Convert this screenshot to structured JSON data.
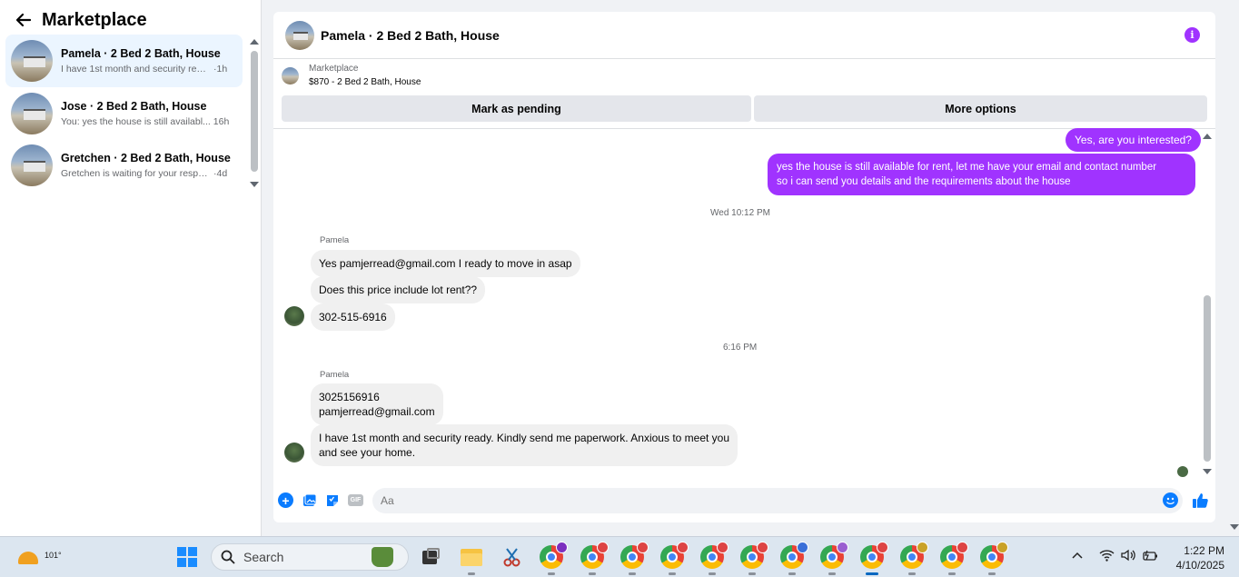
{
  "sidebar": {
    "title": "Marketplace",
    "conversations": [
      {
        "name": "Pamela · 2 Bed 2 Bath, House",
        "snippet": "I have 1st month and security read...",
        "time": "1h"
      },
      {
        "name": "Jose · 2 Bed 2 Bath, House",
        "snippet": "You: yes the house is still availabl...",
        "time": "16h"
      },
      {
        "name": "Gretchen · 2 Bed 2 Bath, House",
        "snippet": "Gretchen is waiting for your respo...",
        "time": "4d"
      }
    ]
  },
  "chat": {
    "title": "Pamela · 2 Bed 2 Bath, House",
    "listing_label": "Marketplace",
    "listing_price": "$870 - 2 Bed 2 Bath, House",
    "buttons": {
      "pending": "Mark as pending",
      "more": "More options"
    },
    "messages": {
      "out1": "Yes, are you interested?",
      "out2_line1": "yes the house is still available for rent, let me have your email  and contact number",
      "out2_line2": "so i can send you details and the requirements about the house",
      "stamp1": "Wed 10:12 PM",
      "sender1": "Pamela",
      "in1": "Yes pamjerread@gmail.com I ready to move in asap",
      "in2": "Does this price include lot rent??",
      "in3": "302-515-6916",
      "stamp2": "6:16 PM",
      "sender2": "Pamela",
      "in4_line1": "3025156916",
      "in4_line2": "pamjerread@gmail.com",
      "in5_line1": "I have 1st month and security ready. Kindly send me paperwork. Anxious to meet you",
      "in5_line2": "and see your home."
    },
    "composer": {
      "placeholder": "Aa",
      "gif_label": "GIF"
    }
  },
  "taskbar": {
    "temperature": "101°",
    "search_label": "Search",
    "time": "1:22 PM",
    "date": "4/10/2025",
    "badge_colors": [
      "#7b2fbf",
      "#d44",
      "#d44",
      "#d44",
      "#d44",
      "#d44",
      "#3a6fd8",
      "#9a5fd0",
      "#d44",
      "#c9a227",
      "#d44",
      "#c9a227"
    ]
  },
  "colors": {
    "accent": "#a033ff",
    "messenger_blue": "#0a7cff"
  }
}
